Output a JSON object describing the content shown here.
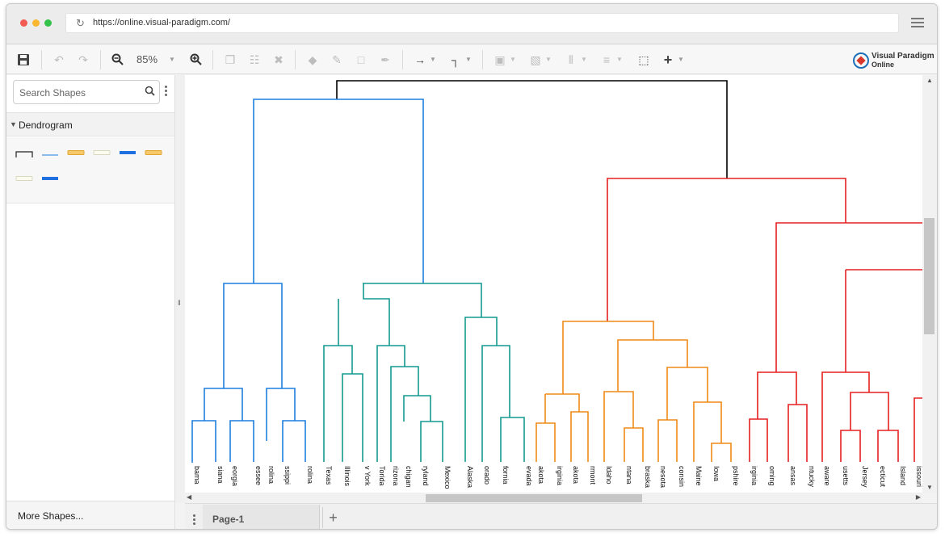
{
  "browser": {
    "url": "https://online.visual-paradigm.com/",
    "dots": [
      "#f25b52",
      "#f7b731",
      "#35c24a"
    ]
  },
  "toolbar": {
    "zoom": "85%",
    "brand_line1": "Visual Paradigm",
    "brand_line2": "Online"
  },
  "sidebar": {
    "search_placeholder": "Search Shapes",
    "category": "Dendrogram",
    "more_shapes": "More Shapes..."
  },
  "pages": {
    "tab_label": "Page-1"
  },
  "colors": {
    "cluster_blue": "#1e7fe0",
    "cluster_teal": "#139a90",
    "cluster_orange": "#ef8a17",
    "cluster_red": "#e52121",
    "root": "#000000"
  },
  "dendrogram": {
    "leaves": [
      "bama",
      "siana",
      "eorgia",
      "essee",
      "rolina",
      "ssippi",
      "rolina",
      "Texas",
      "Illinois",
      "v York",
      "Torida",
      "rizona",
      "chigan",
      "ryland",
      "Mexico",
      "Alaska",
      "orado",
      "fornia",
      "evada",
      "akota",
      "irginia",
      "akota",
      "rmont",
      "Idaho",
      "ntana",
      "braska",
      "nesota",
      "consin",
      "Maine",
      "Iowa",
      "pshire",
      "irginia",
      "oming",
      "ansas",
      "ntucky",
      "aware",
      "usetts",
      "Jersey",
      "ecticut",
      "Island",
      "issouri"
    ]
  }
}
